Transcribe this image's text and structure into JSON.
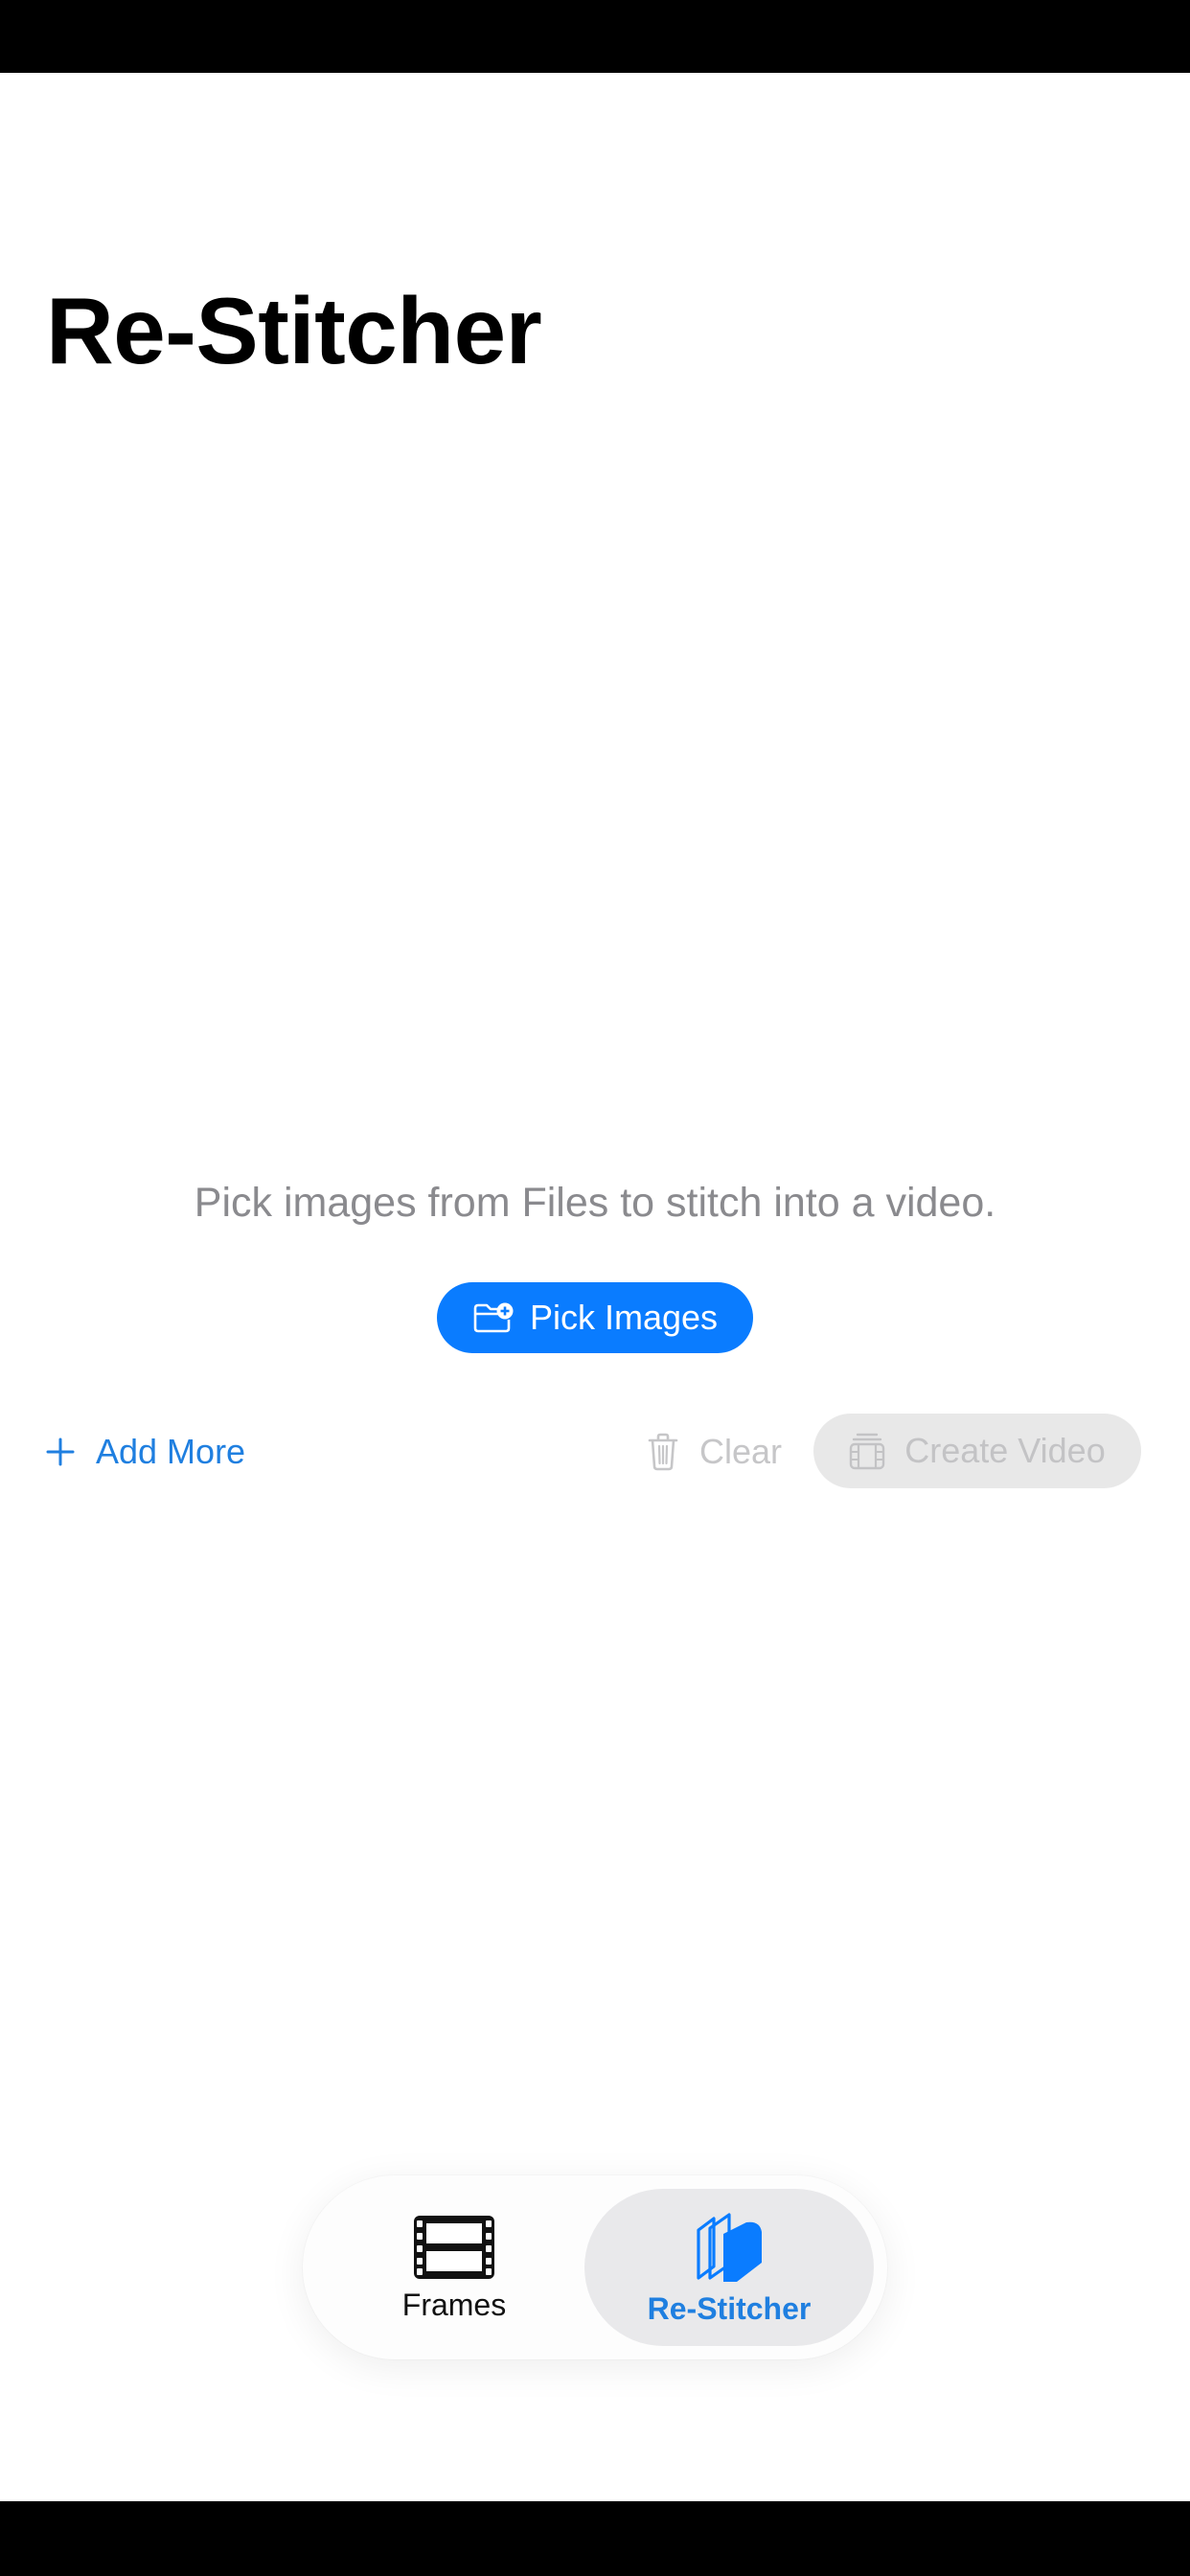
{
  "header": {
    "title": "Re-Stitcher"
  },
  "main": {
    "empty_message": "Pick images from Files to stitch into a video.",
    "pick_images_label": "Pick Images",
    "add_more_label": "Add More",
    "clear_label": "Clear",
    "create_video_label": "Create Video"
  },
  "tab_bar": {
    "tabs": [
      {
        "label": "Frames",
        "icon": "film-icon",
        "selected": false
      },
      {
        "label": "Re-Stitcher",
        "icon": "stack-icon",
        "selected": true
      }
    ]
  },
  "colors": {
    "accent": "#0a7cff",
    "link_blue": "#1f7fe0",
    "disabled_text": "#c6c6c8",
    "secondary_text": "#8a8a8e",
    "disabled_fill": "#e8e8e8"
  }
}
